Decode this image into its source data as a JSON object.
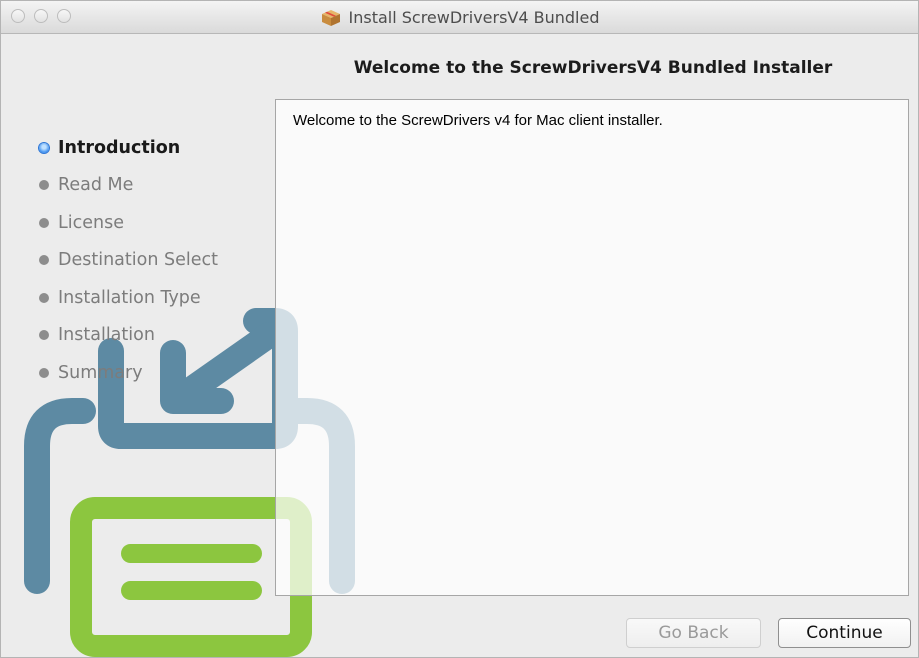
{
  "window": {
    "title": "Install ScrewDriversV4 Bundled",
    "title_icon": "package-icon"
  },
  "page": {
    "heading": "Welcome to the ScrewDriversV4 Bundled Installer"
  },
  "sidebar": {
    "steps": [
      {
        "label": "Introduction",
        "active": true
      },
      {
        "label": "Read Me",
        "active": false
      },
      {
        "label": "License",
        "active": false
      },
      {
        "label": "Destination Select",
        "active": false
      },
      {
        "label": "Installation Type",
        "active": false
      },
      {
        "label": "Installation",
        "active": false
      },
      {
        "label": "Summary",
        "active": false
      }
    ]
  },
  "content": {
    "text": "Welcome to the ScrewDrivers v4 for Mac client installer."
  },
  "buttons": {
    "back_label": "Go Back",
    "back_enabled": false,
    "continue_label": "Continue"
  },
  "colors": {
    "logo_blue": "#5d8aa3",
    "logo_green": "#8cc63f",
    "active_step": "#3c8ff0"
  }
}
